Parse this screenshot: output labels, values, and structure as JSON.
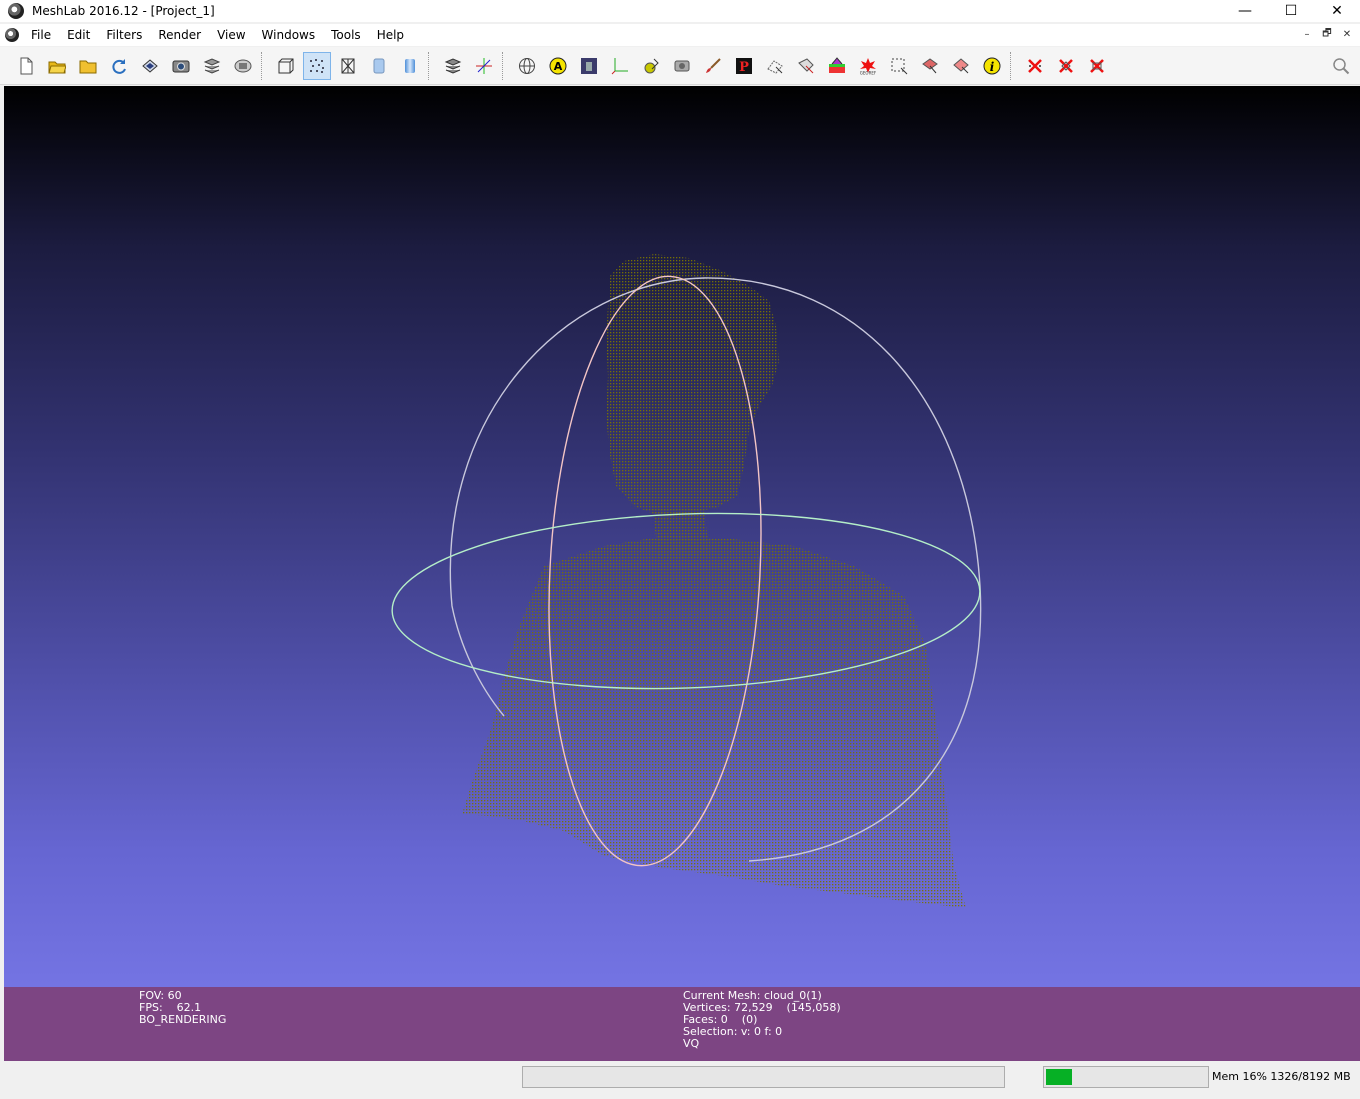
{
  "window": {
    "title": "MeshLab 2016.12 - [Project_1]",
    "controls": [
      "—",
      "☐",
      "✕"
    ]
  },
  "menubar": {
    "items": [
      "File",
      "Edit",
      "Filters",
      "Render",
      "View",
      "Windows",
      "Tools",
      "Help"
    ],
    "mdi_controls": [
      "–",
      "🗗",
      "✕"
    ]
  },
  "toolbar": {
    "active_tool": "render-points",
    "groups": [
      [
        "new-project",
        "open-project",
        "open-mesh",
        "reload",
        "export-mesh",
        "snapshot",
        "layers",
        "raster"
      ],
      [
        "render-bbox",
        "render-points",
        "render-wireframe",
        "render-flat",
        "render-smooth"
      ],
      [
        "show-layer-dialog",
        "show-axis"
      ],
      [
        "align",
        "annotate",
        "raster-tool",
        "manipulator",
        "paint-select",
        "camera",
        "paint-brush",
        "pick-points",
        "select-vertex",
        "select-connected",
        "fill-color",
        "select-faces",
        "georef",
        "select-rect",
        "select-z",
        "select-poly",
        "info"
      ],
      [
        "delete-vertices",
        "delete-faces",
        "delete-selected"
      ]
    ]
  },
  "viewport": {
    "trackball": {
      "horizontal_color": "#b4eec8",
      "vertical_color": "#f3c5c5",
      "outer_color": "#c8c8dc"
    },
    "point_color": "#7a7400"
  },
  "info_left": {
    "fov": "FOV: 60",
    "fps": "FPS:    62.1",
    "mode": "BO_RENDERING"
  },
  "info_right": {
    "mesh": "Current Mesh: cloud_0(1)",
    "vertices": "Vertices: 72,529    (145,058)",
    "faces": "Faces: 0    (0)",
    "selection": "Selection: v: 0 f: 0",
    "vq": "VQ"
  },
  "status": {
    "memory_label": "Mem 16% 1326/8192 MB",
    "memory_fraction": 0.16
  }
}
